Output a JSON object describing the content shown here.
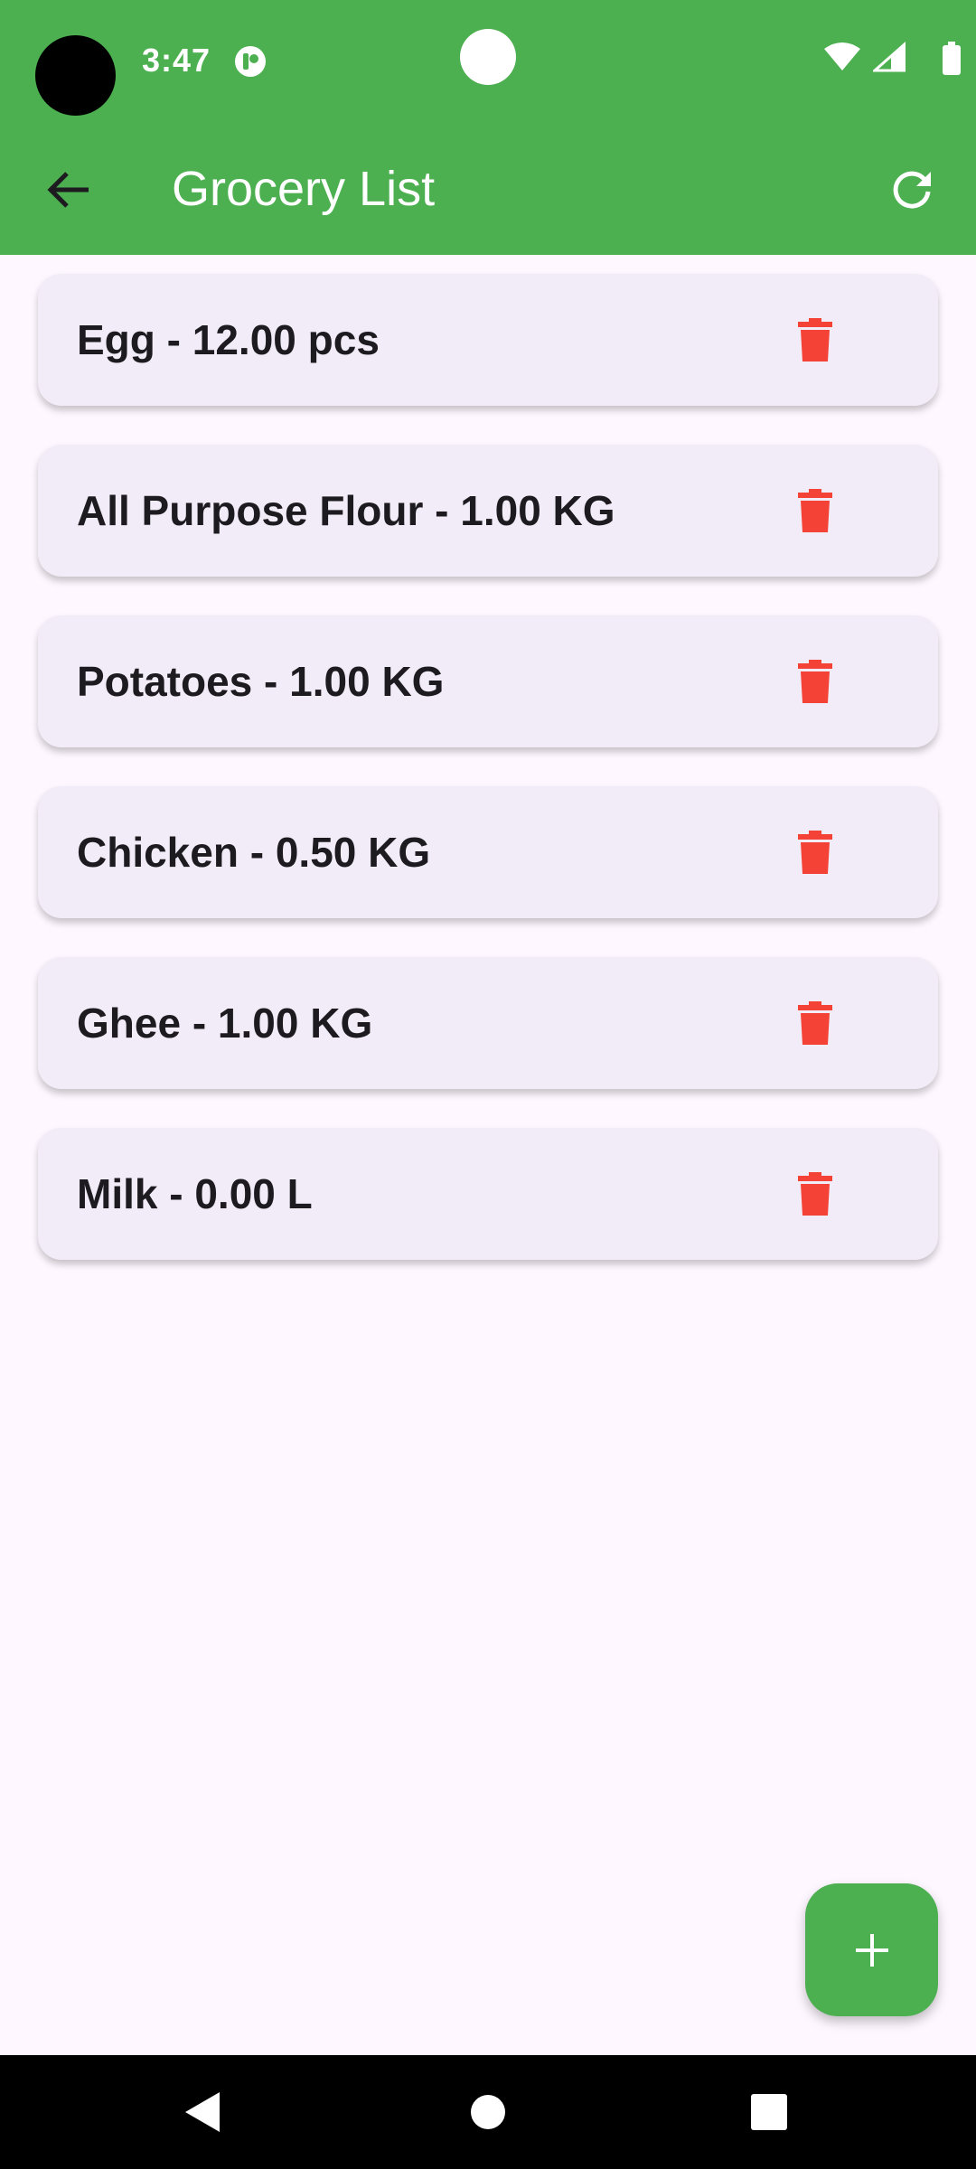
{
  "status_bar": {
    "time": "3:47",
    "icons": [
      "notification-icon",
      "wifi-icon",
      "signal-icon",
      "battery-icon"
    ]
  },
  "app_bar": {
    "title": "Grocery List",
    "back_icon": "arrow-back-icon",
    "refresh_icon": "refresh-icon",
    "color": "#4CAF50"
  },
  "items": [
    {
      "label": "Egg - 12.00 pcs"
    },
    {
      "label": "All Purpose Flour - 1.00 KG"
    },
    {
      "label": "Potatoes - 1.00 KG"
    },
    {
      "label": "Chicken - 0.50 KG"
    },
    {
      "label": "Ghee - 1.00 KG"
    },
    {
      "label": "Milk - 0.00 L"
    }
  ],
  "item_action_icon": "delete-icon",
  "delete_color": "#F44336",
  "fab": {
    "icon": "add-icon"
  },
  "nav_bar": {
    "icons": [
      "back-triangle-icon",
      "home-circle-icon",
      "recents-square-icon"
    ]
  }
}
